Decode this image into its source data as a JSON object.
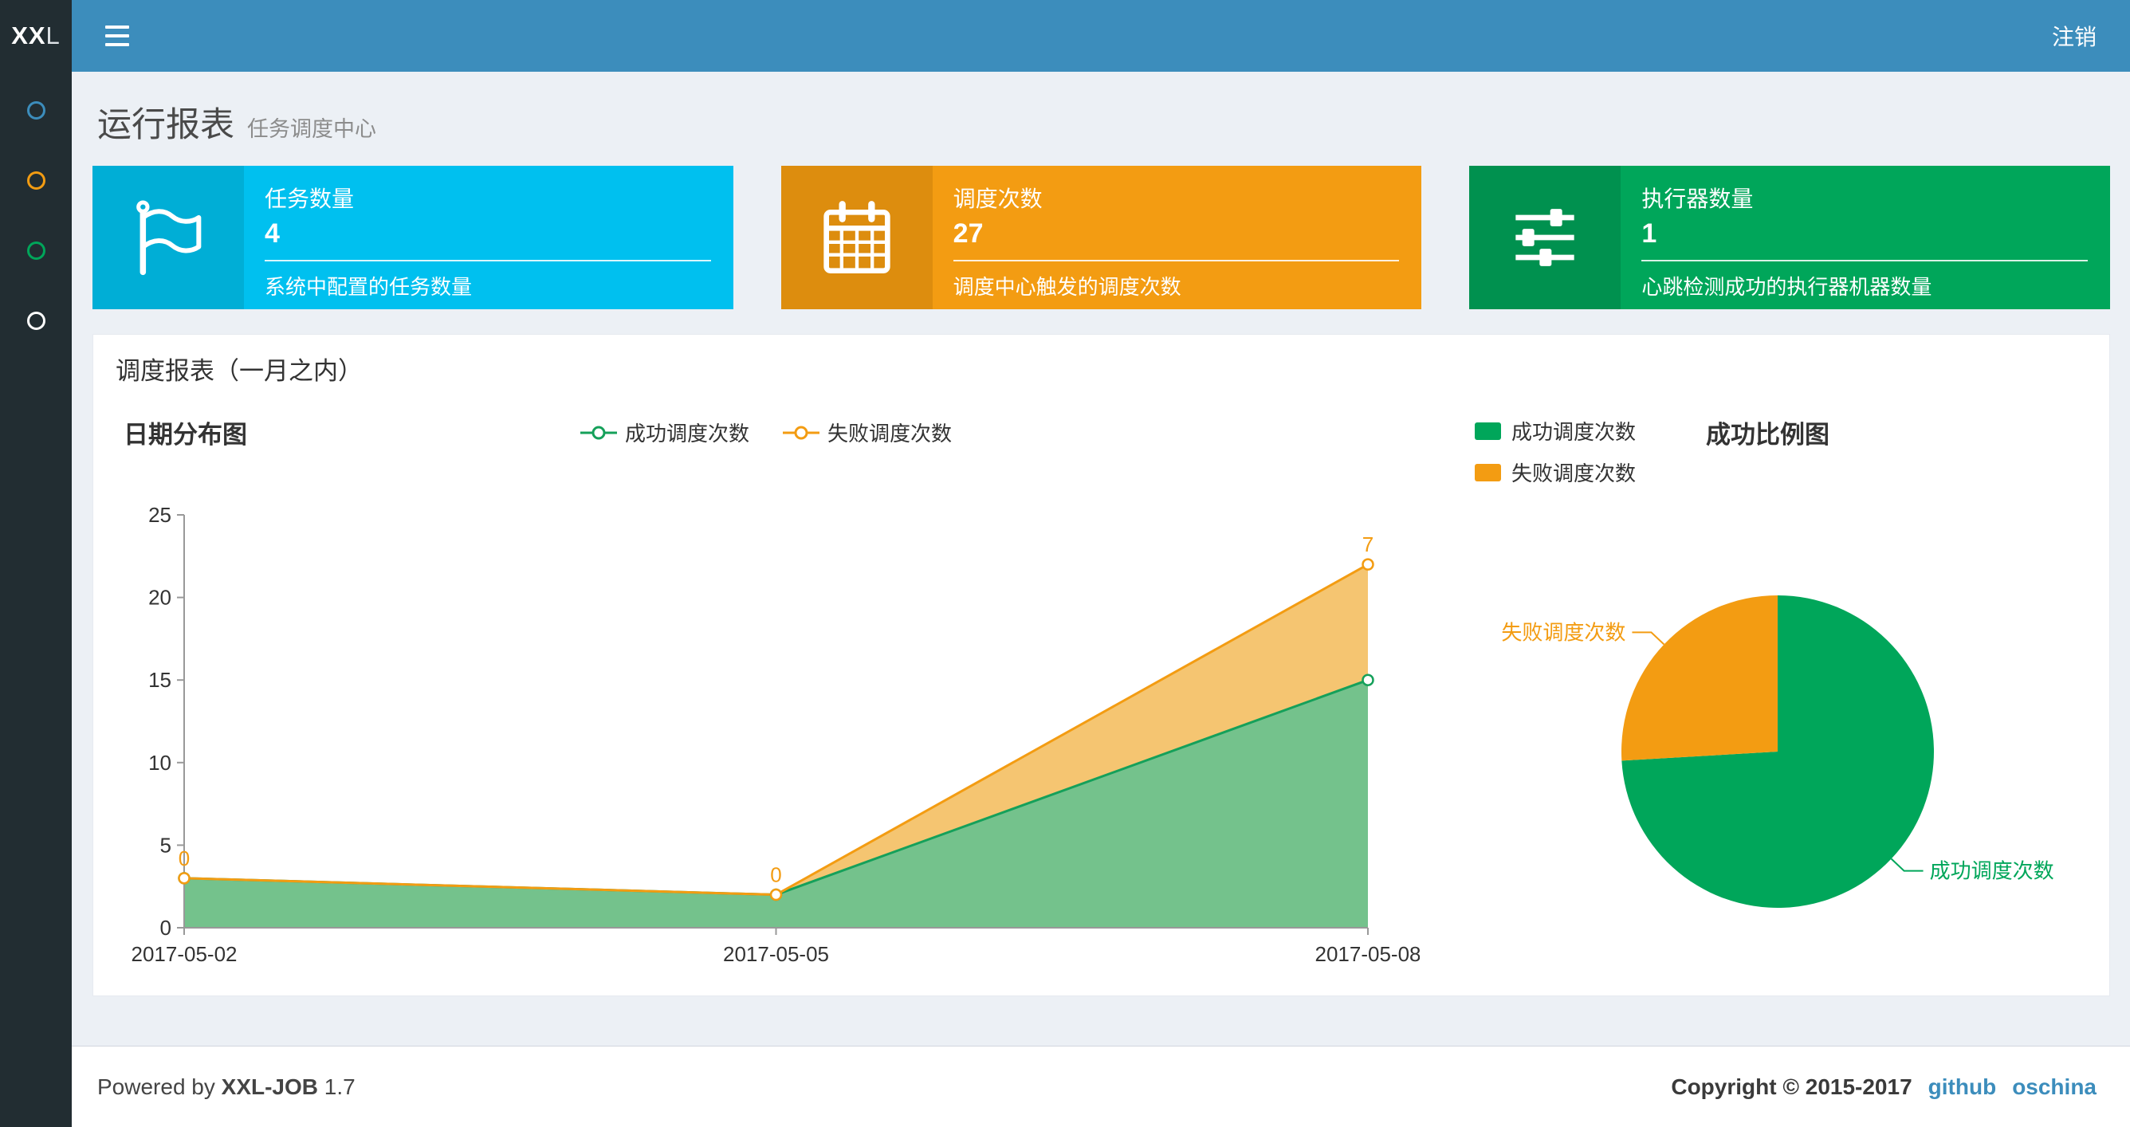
{
  "navbar": {
    "logo_bold": "XX",
    "logo_rest": "L",
    "logout_label": "注销"
  },
  "sidebar": {
    "items": [
      {
        "icon": "circle-o-icon",
        "color": "#3c8dbc"
      },
      {
        "icon": "circle-o-icon",
        "color": "#f39c12"
      },
      {
        "icon": "circle-o-icon",
        "color": "#00a65a"
      },
      {
        "icon": "circle-o-icon",
        "color": "#ffffff"
      }
    ]
  },
  "page_header": {
    "title": "运行报表",
    "subtitle": "任务调度中心"
  },
  "info_boxes": [
    {
      "label": "任务数量",
      "value": "4",
      "desc": "系统中配置的任务数量",
      "bg": "#00c0ef",
      "icon_bg": "#00aed6",
      "icon": "flag-icon"
    },
    {
      "label": "调度次数",
      "value": "27",
      "desc": "调度中心触发的调度次数",
      "bg": "#f39c12",
      "icon_bg": "#dd8d0e",
      "icon": "calendar-icon"
    },
    {
      "label": "执行器数量",
      "value": "1",
      "desc": "心跳检测成功的执行器机器数量",
      "bg": "#00a65a",
      "icon_bg": "#00914f",
      "icon": "sliders-icon"
    }
  ],
  "panel": {
    "title": "调度报表（一月之内）"
  },
  "chart_data": [
    {
      "type": "area",
      "title": "日期分布图",
      "x": [
        "2017-05-02",
        "2017-05-05",
        "2017-05-08"
      ],
      "series": [
        {
          "name": "成功调度次数",
          "values": [
            3,
            2,
            15
          ],
          "color": "#15a05a",
          "fill": "#74c28c"
        },
        {
          "name": "失败调度次数",
          "values": [
            0,
            0,
            7
          ],
          "color": "#f39c12",
          "fill": "#f5c571",
          "point_labels": [
            "0",
            "0",
            "7"
          ]
        }
      ],
      "stacked": true,
      "ylim": [
        0,
        25
      ],
      "yticks": [
        0,
        5,
        10,
        15,
        20,
        25
      ],
      "grid": false,
      "legend_position": "top-center"
    },
    {
      "type": "pie",
      "title": "成功比例图",
      "slices": [
        {
          "name": "成功调度次数",
          "value": 20,
          "color": "#00a65a"
        },
        {
          "name": "失败调度次数",
          "value": 7,
          "color": "#f39c12"
        }
      ],
      "legend_position": "top-left"
    }
  ],
  "footer": {
    "powered_prefix": "Powered by",
    "product": "XXL-JOB",
    "version": "1.7",
    "copyright": "Copyright © 2015-2017",
    "links": [
      "github",
      "oschina"
    ]
  }
}
